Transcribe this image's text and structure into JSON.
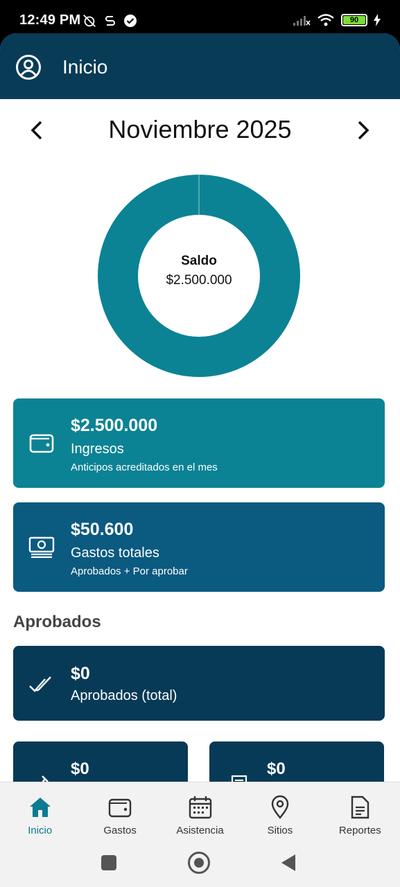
{
  "status_bar": {
    "time": "12:49 PM",
    "battery": "90"
  },
  "app_bar": {
    "title": "Inicio",
    "avatar_icon": "account-circle-icon"
  },
  "month_nav": {
    "month": "Noviembre 2025",
    "prev_icon": "chevron-left-icon",
    "next_icon": "chevron-right-icon"
  },
  "donut": {
    "label": "Saldo",
    "value": "$2.500.000",
    "color": "#0b8394"
  },
  "cards": {
    "ingresos": {
      "amount": "$2.500.000",
      "label": "Ingresos",
      "sub": "Anticipos acreditados en el mes",
      "icon": "wallet-icon",
      "color": "#0b8394"
    },
    "gastos": {
      "amount": "$50.600",
      "label": "Gastos totales",
      "sub": "Aprobados + Por aprobar",
      "icon": "cash-icon",
      "color": "#0b5a80"
    }
  },
  "aprobados": {
    "section_title": "Aprobados",
    "total": {
      "amount": "$0",
      "label": "Aprobados (total)",
      "icon": "double-check-icon",
      "color": "#073a56"
    },
    "mini": [
      {
        "amount": "$0",
        "icon": "tool-icon"
      },
      {
        "amount": "$0",
        "icon": "receipt-icon"
      }
    ]
  },
  "bottom_nav": [
    {
      "label": "Inicio",
      "icon": "home-icon",
      "active": true
    },
    {
      "label": "Gastos",
      "icon": "wallet-icon"
    },
    {
      "label": "Asistencia",
      "icon": "calendar-icon"
    },
    {
      "label": "Sitios",
      "icon": "location-pin-icon"
    },
    {
      "label": "Reportes",
      "icon": "document-icon"
    }
  ]
}
